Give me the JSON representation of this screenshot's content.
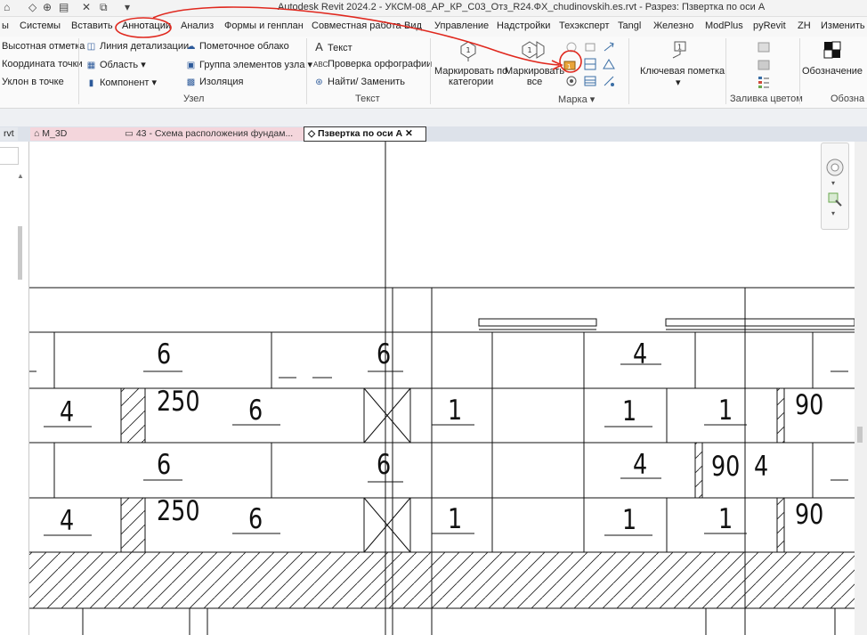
{
  "window": {
    "title": "Autodesk Revit 2024.2 - УКСМ-08_АР_КР_С03_Отз_R24.ФХ_chudinovskih.es.rvt - Разрез: Пзвертка по оси А"
  },
  "menu": {
    "tabs": [
      "ы",
      "Системы",
      "Вставить",
      "Аннотации",
      "Анализ",
      "Формы и генплан",
      "Совместная работа",
      "Вид",
      "Управление",
      "Надстройки",
      "Техэксперт",
      "Tangl",
      "Железно",
      "ModPlus",
      "pyRevit",
      "ZH",
      "Изменить"
    ],
    "active_tab": "Аннотации"
  },
  "ribbon": {
    "col1": [
      "Высотная отметка",
      "Координата точки",
      "Уклон в точке"
    ],
    "col2": [
      "Линия детализации",
      "Область",
      "Компонент"
    ],
    "col3": [
      "Пометочное облако",
      "Группа элементов узла",
      "Изоляция"
    ],
    "col4": [
      "Текст",
      "Проверка орфографии",
      "Найти/ Заменить"
    ],
    "tag_by_category": "Маркировать по\nкатегории",
    "tag_all": "Маркировать\nвсе",
    "keynote": "Ключевая пометка",
    "symbol": "Обозначение",
    "panels": {
      "uzel": "Узел",
      "text": "Текст",
      "marka": "Марка",
      "color_fill": "Заливка цветом",
      "oboz": "Обозна"
    }
  },
  "doc_tabs": {
    "left_stub": "rvt",
    "tabs": [
      {
        "label": "М_3D",
        "active": false
      },
      {
        "label": "43 - Схема расположения фундам...",
        "active": false
      },
      {
        "label": "Пзвертка по оси А",
        "active": true
      }
    ]
  },
  "drawing": {
    "labels": [
      "6",
      "6",
      "4",
      "4",
      "250",
      "6",
      "1",
      "1",
      "1",
      "90",
      "6",
      "6",
      "4",
      "90",
      "4",
      "4",
      "250",
      "6",
      "1",
      "1",
      "1",
      "90"
    ]
  },
  "colors": {
    "annotation_red": "#e0281e",
    "tab_inactive": "#f4d6dc",
    "ribbon_bg": "#fafafa"
  }
}
